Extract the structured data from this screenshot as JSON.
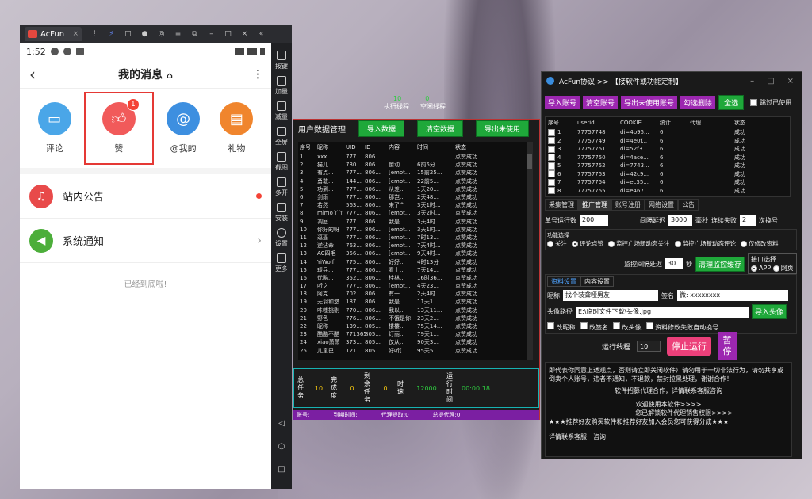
{
  "emulator": {
    "tab_label": "AcFun",
    "side_buttons": [
      "按键",
      "加量",
      "减量",
      "全屏",
      "截图",
      "多开",
      "安装",
      "设置",
      "更多"
    ]
  },
  "phone": {
    "time": "1:52",
    "title": "我的消息",
    "quick": [
      {
        "label": "评论",
        "color": "#4aa6e8",
        "icon": "comment-icon"
      },
      {
        "label": "赞",
        "color": "#f15a5a",
        "icon": "thumb-up-icon",
        "badge": "1"
      },
      {
        "label": "@我的",
        "color": "#3d8fe0",
        "icon": "at-icon"
      },
      {
        "label": "礼物",
        "color": "#f0852d",
        "icon": "gift-icon"
      }
    ],
    "rows": [
      {
        "label": "站内公告",
        "color": "#e84a4a"
      },
      {
        "label": "系统通知",
        "color": "#4cae3a"
      }
    ],
    "bottom_tip": "已经到底啦!"
  },
  "threads": {
    "exec_count": "10",
    "idle_count": "0",
    "exec_label": "执行线程",
    "idle_label": "空闲线程"
  },
  "datawin": {
    "title": "用户数据管理",
    "btn_import": "导入数据",
    "btn_clear": "清空数据",
    "btn_export": "导出未使用",
    "headers": [
      "序号",
      "昵称",
      "UID",
      "ID",
      "内容",
      "时间",
      "状态"
    ],
    "rows": [
      [
        "1",
        "xxx",
        "777...",
        "806...",
        "",
        "",
        "点赞成功"
      ],
      [
        "2",
        "猫儿",
        "730...",
        "806...",
        "傻动...",
        "6前5分",
        "点赞成功"
      ],
      [
        "3",
        "有点...",
        "777...",
        "806...",
        "[emot...",
        "15前25...",
        "点赞成功"
      ],
      [
        "4",
        "勇敢...",
        "144...",
        "806...",
        "[emot...",
        "22前5...",
        "点赞成功"
      ],
      [
        "5",
        "功到...",
        "777...",
        "806...",
        "从差...",
        "1天20...",
        "点赞成功"
      ],
      [
        "6",
        "剑雨",
        "777...",
        "806...",
        "那岂...",
        "2天48...",
        "点赞成功"
      ],
      [
        "7",
        "若然",
        "563...",
        "806...",
        "来了^",
        "3天1时...",
        "点赞成功"
      ],
      [
        "8",
        "mimo丫丫",
        "777...",
        "806...",
        "[emot...",
        "3天2时...",
        "点赞成功"
      ],
      [
        "9",
        "凋庭",
        "777...",
        "806...",
        "我是...",
        "3天4时...",
        "点赞成功"
      ],
      [
        "10",
        "你好的呀",
        "777...",
        "806...",
        "[emot...",
        "3天1时...",
        "点赞成功"
      ],
      [
        "11",
        "逗逼",
        "777...",
        "806...",
        "[emot...",
        "7时13...",
        "点赞成功"
      ],
      [
        "12",
        "逆沾命",
        "763...",
        "806...",
        "[emot...",
        "7天4时...",
        "点赞成功"
      ],
      [
        "13",
        "AC四毛",
        "356...",
        "806...",
        "[emot...",
        "9天4时...",
        "点赞成功"
      ],
      [
        "14",
        "YiWolf",
        "775...",
        "806...",
        "好好...",
        "4时13分",
        "点赞成功"
      ],
      [
        "15",
        "瑷兵...",
        "777...",
        "806...",
        "看上...",
        "7天14...",
        "点赞成功"
      ],
      [
        "16",
        "优酷...",
        "352...",
        "806...",
        "桂林...",
        "16时36...",
        "点赞成功"
      ],
      [
        "17",
        "听之",
        "777...",
        "806...",
        "[emot...",
        "4天23...",
        "点赞成功"
      ],
      [
        "18",
        "阿克...",
        "702...",
        "806...",
        "有一...",
        "2天4时...",
        "点赞成功"
      ],
      [
        "19",
        "无羽和悠",
        "187...",
        "806...",
        "我是...",
        "11天1...",
        "点赞成功"
      ],
      [
        "20",
        "咔嗤挑剔",
        "770...",
        "806...",
        "我以...",
        "13天11...",
        "点赞成功"
      ],
      [
        "21",
        "野色",
        "776...",
        "806...",
        "不饿是你",
        "23天2...",
        "点赞成功"
      ],
      [
        "22",
        "昵称",
        "139...",
        "805...",
        "楼楼...",
        "75天14...",
        "点赞成功"
      ],
      [
        "23",
        "酷酷不酷",
        "771365",
        "805...",
        "灯丽...",
        "79天1...",
        "点赞成功"
      ],
      [
        "24",
        "xiao萧萧",
        "373...",
        "805...",
        "仅从...",
        "90天3...",
        "点赞成功"
      ],
      [
        "25",
        "儿童巴",
        "121...",
        "805...",
        "好听[...",
        "95天5...",
        "点赞成功"
      ]
    ],
    "stats": [
      {
        "label": "总任务",
        "value": "10"
      },
      {
        "label": "完成度",
        "value": "0"
      },
      {
        "label": "剩余任务",
        "value": "0"
      },
      {
        "label": "时速",
        "value": "12000"
      },
      {
        "label": "运行时间",
        "value": "00:00:18"
      }
    ],
    "footer": [
      "账号:",
      "到期时间:",
      "代理提取:0",
      "总提代理:0"
    ]
  },
  "acwin": {
    "title": "AcFun协议 >> 【接软件或功能定制】",
    "buttons": [
      "导入账号",
      "清空账号",
      "导出未使用账号",
      "勾选删除",
      "全选"
    ],
    "skip_used": "跳过已使用",
    "headers": [
      "序号",
      "userid",
      "COOKIE",
      "统计",
      "代理",
      "状态"
    ],
    "rows": [
      [
        "1",
        "77757748",
        "di=4b95...",
        "6",
        "",
        "成功"
      ],
      [
        "2",
        "77757749",
        "di=4e0f...",
        "6",
        "",
        "成功"
      ],
      [
        "3",
        "77757751",
        "di=52f3...",
        "6",
        "",
        "成功"
      ],
      [
        "4",
        "77757750",
        "di=4ace...",
        "6",
        "",
        "成功"
      ],
      [
        "5",
        "77757752",
        "di=7743...",
        "6",
        "",
        "成功"
      ],
      [
        "6",
        "77757753",
        "di=42c9...",
        "6",
        "",
        "成功"
      ],
      [
        "7",
        "77757754",
        "di=ec35...",
        "6",
        "",
        "成功"
      ],
      [
        "8",
        "77757755",
        "di=e467",
        "6",
        "",
        "成功"
      ]
    ],
    "tabs": [
      "采集管理",
      "推广管理",
      "账号注册",
      "网络设置",
      "公告"
    ],
    "single_run_label": "单号运行数",
    "single_run_value": "200",
    "interval_label": "间隔延迟",
    "interval_value": "3000",
    "ms": "毫秒",
    "fail_label": "连续失败",
    "fail_value": "2",
    "switch_label": "次换号",
    "func_label": "功能选择",
    "funcs": [
      "关注",
      "评论点赞",
      "监控广场新动态关注",
      "监控广场新动态评论",
      "仅修改资料"
    ],
    "monitor_label": "监控间隔延迟",
    "monitor_value": "30",
    "sec": "秒",
    "clear_cache": "清理监控缓存",
    "iface_label": "接口选择",
    "iface": [
      "APP",
      "网页"
    ],
    "subtabs": [
      "资料设置",
      "内容设置"
    ],
    "nick_label": "昵称",
    "nick_value": "找个装聋哑男友",
    "sign_label": "签名",
    "sign_value": "微: xxxxxxxx",
    "avatar_label": "头像路径",
    "avatar_value": "E:\\临时文件下载\\头像.jpg",
    "import_avatar": "导入头像",
    "checks": [
      "改昵称",
      "改签名",
      "改头像",
      "资料修改失败自动换号"
    ],
    "thread_label": "运行线程",
    "thread_value": "10",
    "stop": "停止运行",
    "pause": "暂停",
    "notes": [
      "即代表你同意上述观点，否则请立即关闭软件）请勿用于一切非法行为，请勿共享或倒卖个人账号，违者不通知，不退款，禁封拉黑处理，谢谢合作！",
      "软件招募代理合作，详情联系客服咨询",
      "欢迎使用本软件>>>>",
      "您已解锁软件代理销售权限>>>>",
      "★★★推荐好友购买软件和推荐好友加入会员您可获得分成★★★",
      "详情联系客服　咨询"
    ]
  }
}
